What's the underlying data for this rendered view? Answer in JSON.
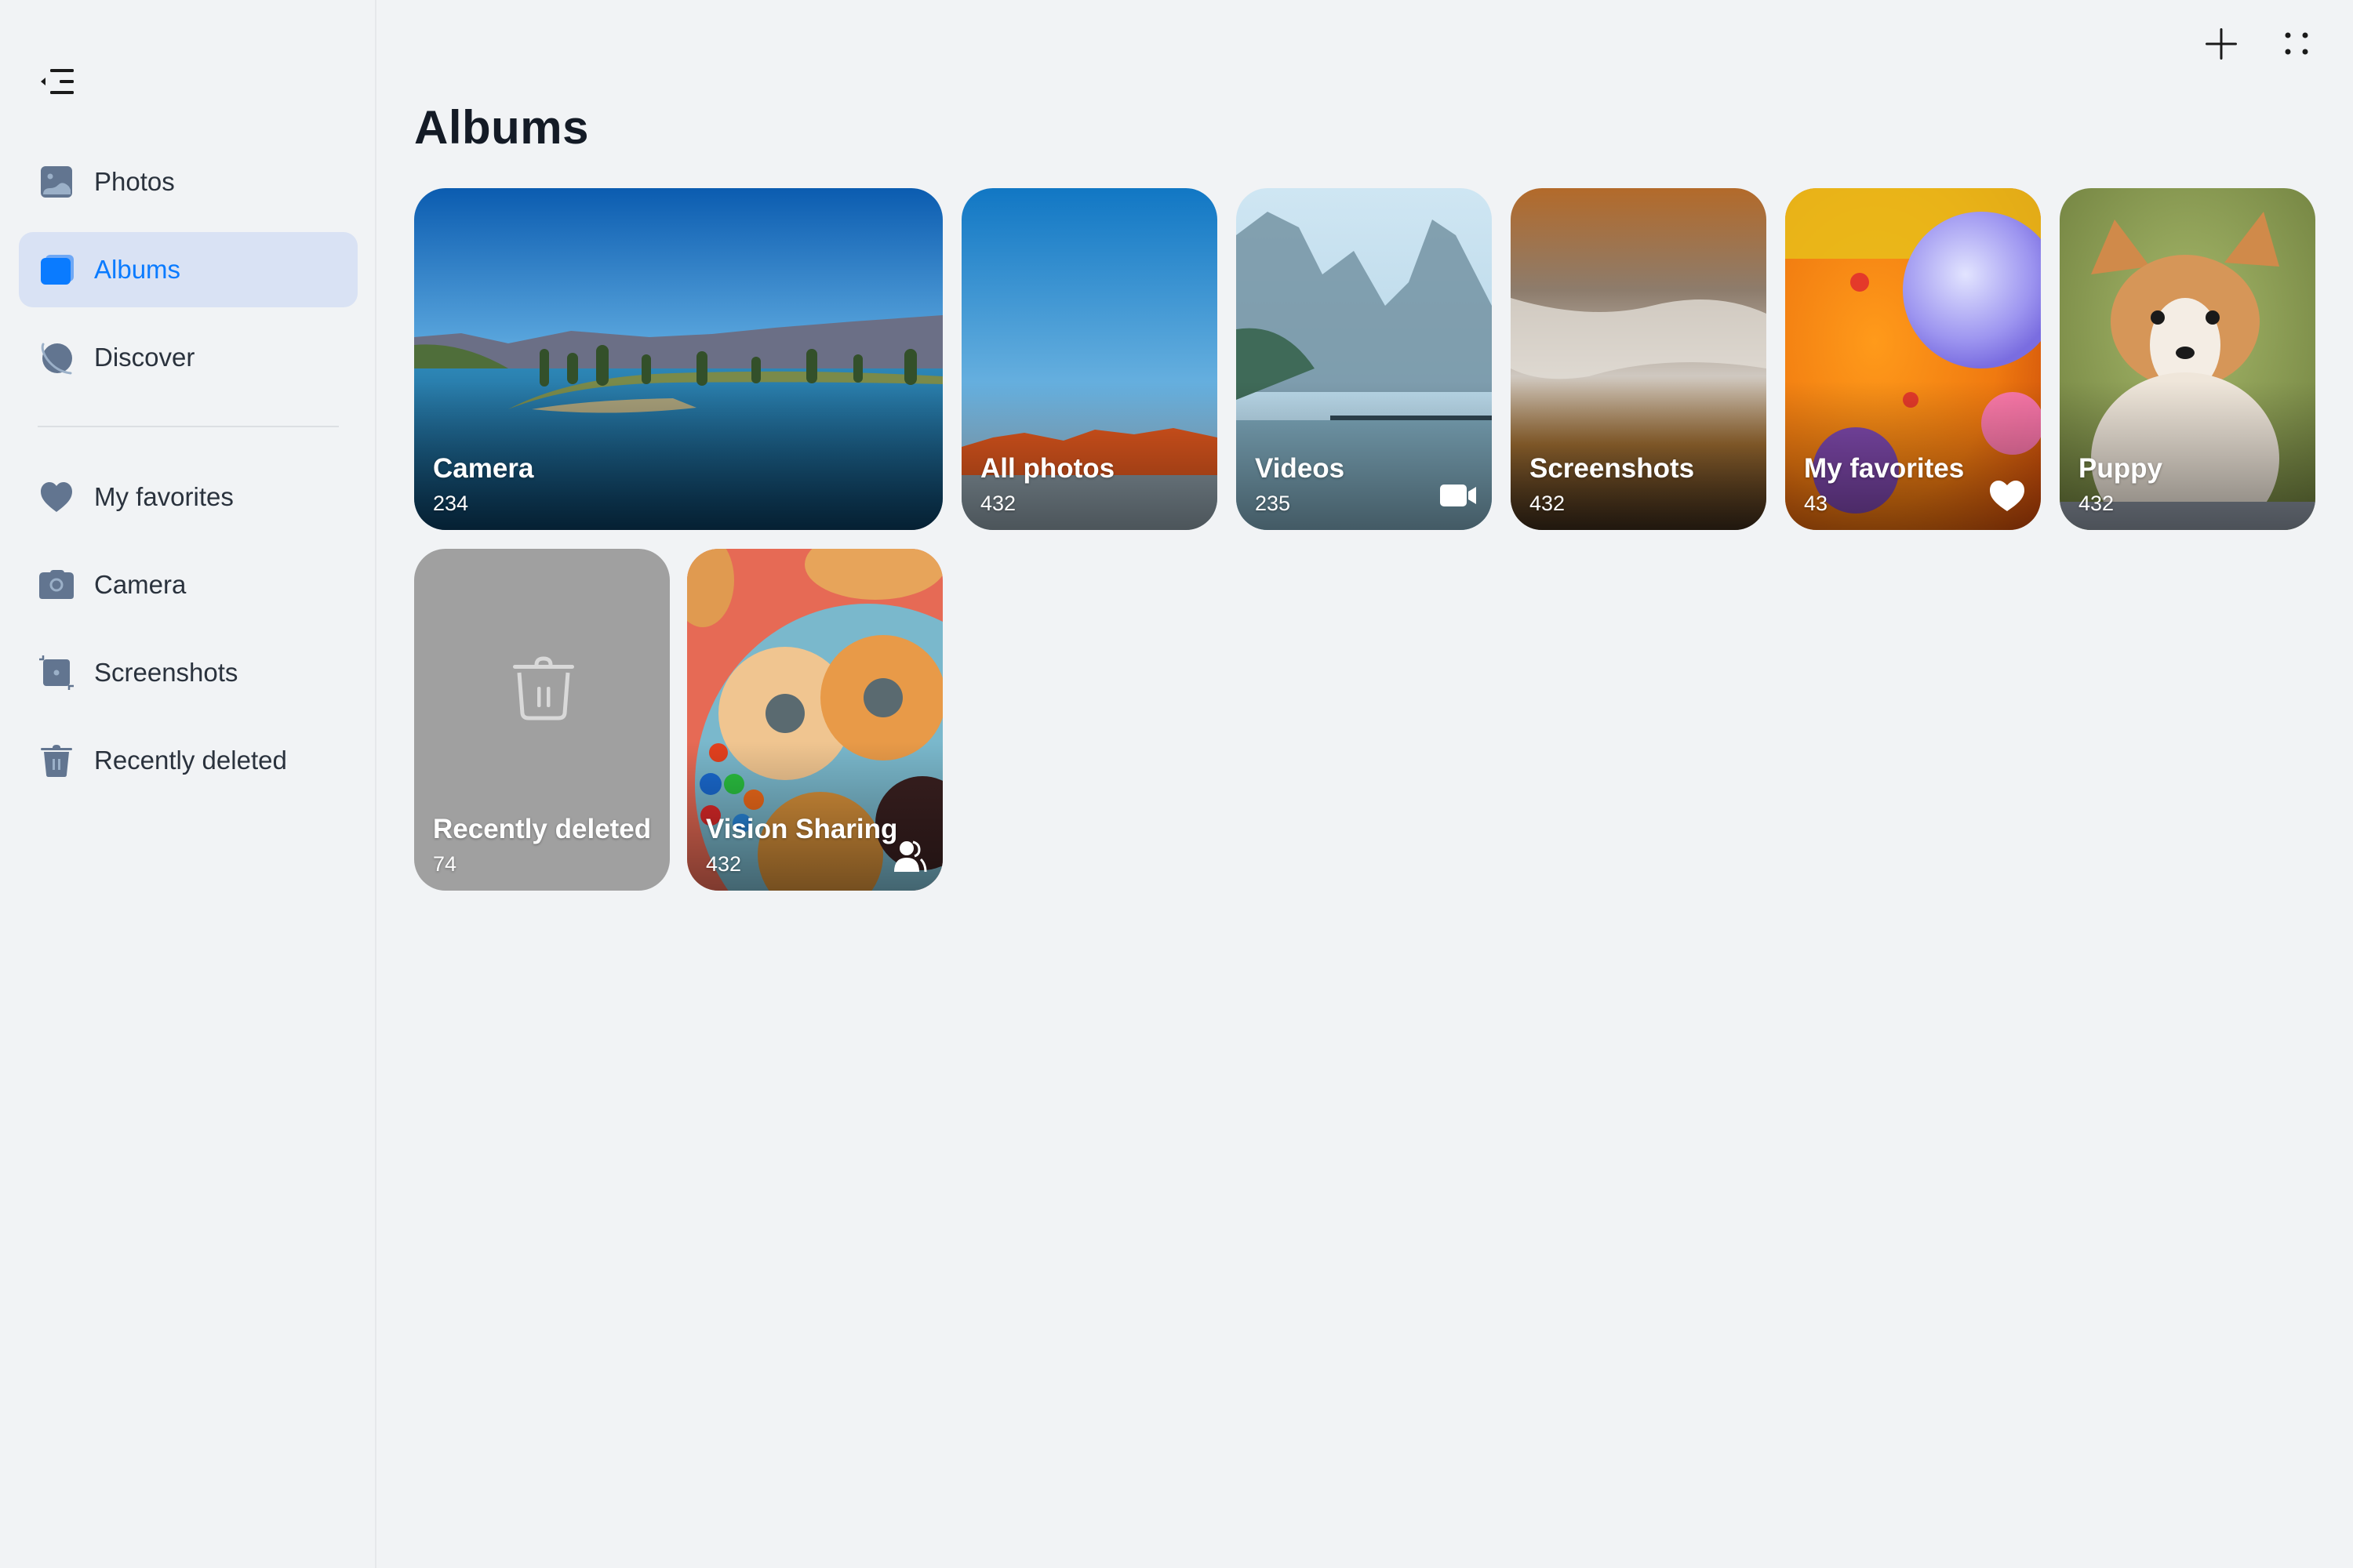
{
  "sidebar": {
    "collapse_icon": "sidebar-collapse-icon",
    "items": [
      {
        "label": "Photos",
        "icon": "image-icon",
        "active": false
      },
      {
        "label": "Albums",
        "icon": "albums-icon",
        "active": true
      },
      {
        "label": "Discover",
        "icon": "planet-icon",
        "active": false
      },
      {
        "label": "My favorites",
        "icon": "heart-icon",
        "active": false
      },
      {
        "label": "Camera",
        "icon": "camera-icon",
        "active": false
      },
      {
        "label": "Screenshots",
        "icon": "screenshot-icon",
        "active": false
      },
      {
        "label": "Recently deleted",
        "icon": "trash-icon",
        "active": false
      }
    ]
  },
  "toolbar": {
    "add_icon": "plus-icon",
    "more_icon": "four-dots-icon"
  },
  "main": {
    "title": "Albums",
    "albums": [
      {
        "name": "Camera",
        "count": "234",
        "badge": null
      },
      {
        "name": "All photos",
        "count": "432",
        "badge": null
      },
      {
        "name": "Videos",
        "count": "235",
        "badge": "video-icon"
      },
      {
        "name": "Screenshots",
        "count": "432",
        "badge": null
      },
      {
        "name": "My favorites",
        "count": "43",
        "badge": "heart-icon"
      },
      {
        "name": "Puppy",
        "count": "432",
        "badge": null
      },
      {
        "name": "Recently deleted",
        "count": "74",
        "badge": "trash-icon"
      },
      {
        "name": "Vision Sharing",
        "count": "432",
        "badge": "shared-people-icon"
      }
    ]
  },
  "colors": {
    "accent": "#0a7bff",
    "active_item_bg": "#d9e2f4",
    "background": "#f1f3f5",
    "icon_gray": "#627590"
  }
}
